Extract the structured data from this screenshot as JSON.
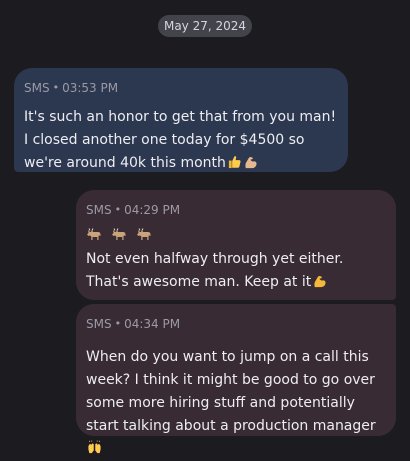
{
  "date_divider": "May 27, 2024",
  "messages": [
    {
      "direction": "incoming",
      "service": "SMS",
      "time": "03:53 PM",
      "text": "It's such an honor to get that from you man! I closed another one today for $4500 so we're around 40k this month",
      "trailing_emoji": [
        "thumbs-up",
        "flexed-biceps"
      ]
    },
    {
      "direction": "outgoing",
      "service": "SMS",
      "time": "04:29 PM",
      "leading_emoji": [
        "goat",
        "goat",
        "goat"
      ],
      "text": "Not even halfway through yet either. That's awesome man. Keep at it",
      "trailing_emoji": [
        "flexed-biceps"
      ]
    },
    {
      "direction": "outgoing",
      "service": "SMS",
      "time": "04:34 PM",
      "text": "When do you want to jump on a call this week? I think it might be good to go over some more hiring stuff and potentially start talking about a production manager",
      "trailing_emoji": [
        "raising-hands"
      ]
    }
  ],
  "colors": {
    "background": "#1c1b20",
    "incoming_bubble": "#2c3750",
    "outgoing_bubble": "#382b34",
    "meta_text": "#9b9aa6",
    "body_text": "#ededf2"
  }
}
